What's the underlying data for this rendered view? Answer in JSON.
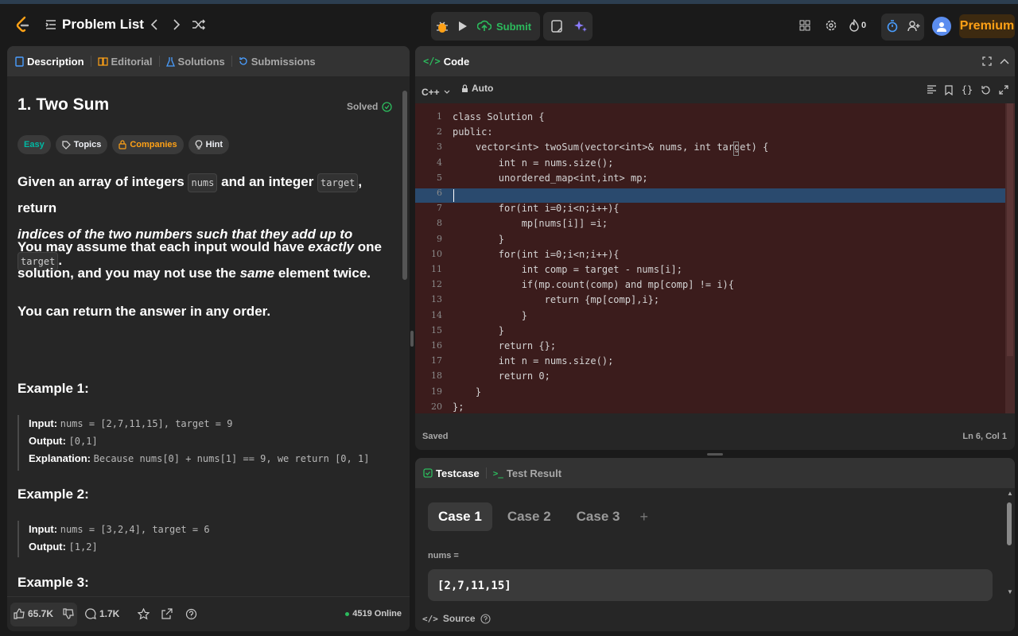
{
  "topbar": {
    "title": "Problem List",
    "submit_label": "Submit",
    "streak_count": "0",
    "premium_label": "Premium"
  },
  "left_tabs": [
    {
      "label": "Description"
    },
    {
      "label": "Editorial"
    },
    {
      "label": "Solutions"
    },
    {
      "label": "Submissions"
    }
  ],
  "problem": {
    "title": "1. Two Sum",
    "status": "Solved",
    "difficulty": "Easy",
    "tags": [
      "Topics",
      "Companies",
      "Hint"
    ],
    "p1a": "Given an array of integers",
    "p1_code1": "nums",
    "p1b": "and an integer",
    "p1_code2": "target",
    "p1c": ", return",
    "p1d": "indices of the two numbers such that they add up to",
    "p1_code3": "target",
    "p1e": ".",
    "p2a": "You may assume that each input would have",
    "p2b": "exactly",
    "p2c": "one solution, and you may not use the",
    "p2d": "same",
    "p2e": "element twice.",
    "p3": "You can return the answer in any order."
  },
  "examples": [
    {
      "title": "Example 1:",
      "input_label": "Input:",
      "input": "nums = [2,7,11,15], target = 9",
      "output_label": "Output:",
      "output": "[0,1]",
      "explanation_label": "Explanation:",
      "explanation": "Because nums[0] + nums[1] == 9, we return [0, 1]"
    },
    {
      "title": "Example 2:",
      "input_label": "Input:",
      "input": "nums = [3,2,4], target = 6",
      "output_label": "Output:",
      "output": "[1,2]"
    },
    {
      "title": "Example 3:"
    }
  ],
  "footer_left": {
    "likes": "65.7K",
    "comments": "1.7K",
    "online": "4519 Online"
  },
  "code_panel": {
    "title": "Code",
    "language": "C++",
    "auto_label": "Auto",
    "saved": "Saved",
    "cursor": "Ln 6, Col 1",
    "lines": [
      "class Solution {",
      "public:",
      "    vector<int> twoSum(vector<int>& nums, int target) {",
      "        int n = nums.size();",
      "        unordered_map<int,int> mp;",
      "",
      "        for(int i=0;i<n;i++){",
      "            mp[nums[i]] =i;",
      "        }",
      "        for(int i=0;i<n;i++){",
      "            int comp = target - nums[i];",
      "            if(mp.count(comp) and mp[comp] != i){",
      "                return {mp[comp],i};",
      "            }",
      "        }",
      "        return {};",
      "        int n = nums.size();",
      "        return 0;",
      "    }",
      "};"
    ],
    "line_numbers": [
      "1",
      "2",
      "3",
      "4",
      "5",
      "6",
      "7",
      "8",
      "9",
      "10",
      "11",
      "12",
      "13",
      "14",
      "15",
      "16",
      "17",
      "18",
      "19",
      "20"
    ]
  },
  "test_panel": {
    "tab1": "Testcase",
    "tab2": "Test Result",
    "cases": [
      "Case 1",
      "Case 2",
      "Case 3"
    ],
    "add": "+",
    "var_label": "nums =",
    "var_value": "[2,7,11,15]",
    "source_label": "Source"
  },
  "colors": {
    "accent_green": "#2cbb5d",
    "premium": "#ffa116",
    "code_bg": "#3b1c1c",
    "highlight": "#2a4a6e",
    "easy": "#00b8a3"
  }
}
